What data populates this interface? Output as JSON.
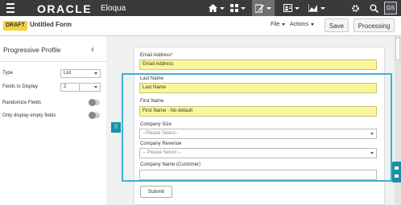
{
  "topnav": {
    "logo_text": "ORACLE",
    "product_name": "Eloqua",
    "icons": [
      "menu-icon",
      "home-icon",
      "grid-icon",
      "edit-icon",
      "contacts-icon",
      "chart-icon",
      "gear-icon",
      "search-icon"
    ],
    "avatar_initials": "GS"
  },
  "toolbar": {
    "status_badge": "DRAFT",
    "form_title": "Untitled Form",
    "file_menu": "File",
    "actions_menu": "Actions",
    "save_label": "Save",
    "processing_label": "Processing"
  },
  "panel": {
    "title": "Progressive Profile",
    "type_label": "Type",
    "type_value": "List",
    "fields_label": "Fields to Display",
    "fields_value": "2",
    "randomize_label": "Randomize Fields",
    "randomize_on": false,
    "empty_only_label": "Only display empty fields",
    "empty_only_on": false
  },
  "form": {
    "fields": [
      {
        "label": "Email Address",
        "required_mark": "*",
        "value": "Email Address",
        "placeholder": "",
        "kind": "text",
        "highlight": true
      },
      {
        "label": "Last Name",
        "required_mark": "",
        "value": "Last Name",
        "placeholder": "",
        "kind": "text",
        "highlight": true
      },
      {
        "label": "First Name",
        "required_mark": "",
        "value": "First Name - No default",
        "placeholder": "",
        "kind": "text",
        "highlight": true
      },
      {
        "label": "Company Size",
        "required_mark": "",
        "value": "",
        "placeholder": "--Please Select--",
        "kind": "select",
        "highlight": false
      },
      {
        "label": "Company Revenue",
        "required_mark": "",
        "value": "",
        "placeholder": "-- Please Select --",
        "kind": "select",
        "highlight": false
      },
      {
        "label": "Company Name (Customer)",
        "required_mark": "",
        "value": "",
        "placeholder": "",
        "kind": "text",
        "highlight": false
      }
    ],
    "submit_label": "Submit",
    "progressive_tab_glyph": "⠿"
  },
  "colors": {
    "nav_bg": "#3a3a3a",
    "draft_badge": "#f5d33c",
    "field_highlight": "#fbf59b",
    "progressive_border": "#3fb1c9",
    "progressive_tab": "#1e8ea8"
  }
}
